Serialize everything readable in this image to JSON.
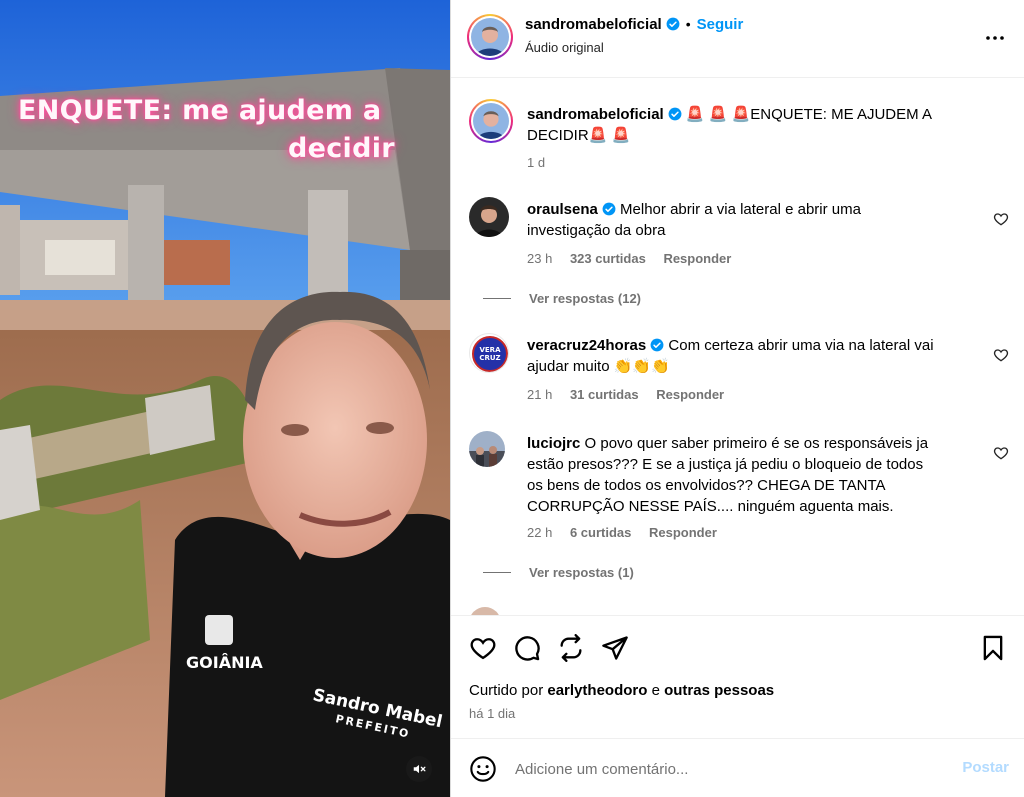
{
  "header": {
    "username": "sandromabeloficial",
    "dot": "•",
    "follow_label": "Seguir",
    "audio_label": "Áudio original"
  },
  "media": {
    "overlay_line1": "ENQUETE: me ajudem a",
    "overlay_line2": "decidir",
    "shirt_logo": "GOIÂNIA",
    "shirt_name": "Sandro Mabel",
    "shirt_role": "PREFEITO",
    "accent_neon": "#ff3b8d"
  },
  "caption": {
    "username": "sandromabeloficial",
    "text_line1": "🚨 🚨 🚨ENQUETE: ME AJUDEM A",
    "text_line2": "DECIDIR🚨 🚨",
    "time": "1 d"
  },
  "comments": [
    {
      "username": "oraulsena",
      "text_line1": "Melhor abrir a via lateral e abrir uma",
      "text_line2": "investigação da obra",
      "time": "23 h",
      "likes": "323 curtidas",
      "reply_label": "Responder",
      "view_replies": "Ver respostas (12)"
    },
    {
      "username": "veracruz24horas",
      "text_line1": "Com certeza abrir uma via na lateral vai",
      "text_line2": "ajudar muito 👏👏👏",
      "time": "21 h",
      "likes": "31 curtidas",
      "reply_label": "Responder",
      "avatar_text": "VERA CRUZ"
    },
    {
      "username": "luciojrc",
      "text_line1": "O povo quer saber primeiro é se os responsáveis ja",
      "text_line2": "estão presos??? E se a justiça já pediu o bloqueio de todos",
      "text_line3": "os bens de todos os envolvidos?? CHEGA DE TANTA",
      "text_line4": "CORRUPÇÃO NESSE PAÍS.... ninguém aguenta mais.",
      "time": "22 h",
      "likes": "6 curtidas",
      "reply_label": "Responder",
      "view_replies": "Ver respostas (1)"
    }
  ],
  "actions": {
    "icons": [
      "heart-icon",
      "comment-icon",
      "share-icon",
      "send-icon",
      "bookmark-icon"
    ],
    "liked_prefix": "Curtido por",
    "liked_user": "earlytheodoro",
    "liked_and": "e",
    "liked_others": "outras pessoas",
    "time": "há 1 dia"
  },
  "add_comment": {
    "placeholder": "Adicione um comentário...",
    "post_label": "Postar"
  },
  "colors": {
    "link_blue": "#0095f6",
    "muted_gray": "#737373",
    "post_disabled": "#b3dbff"
  }
}
